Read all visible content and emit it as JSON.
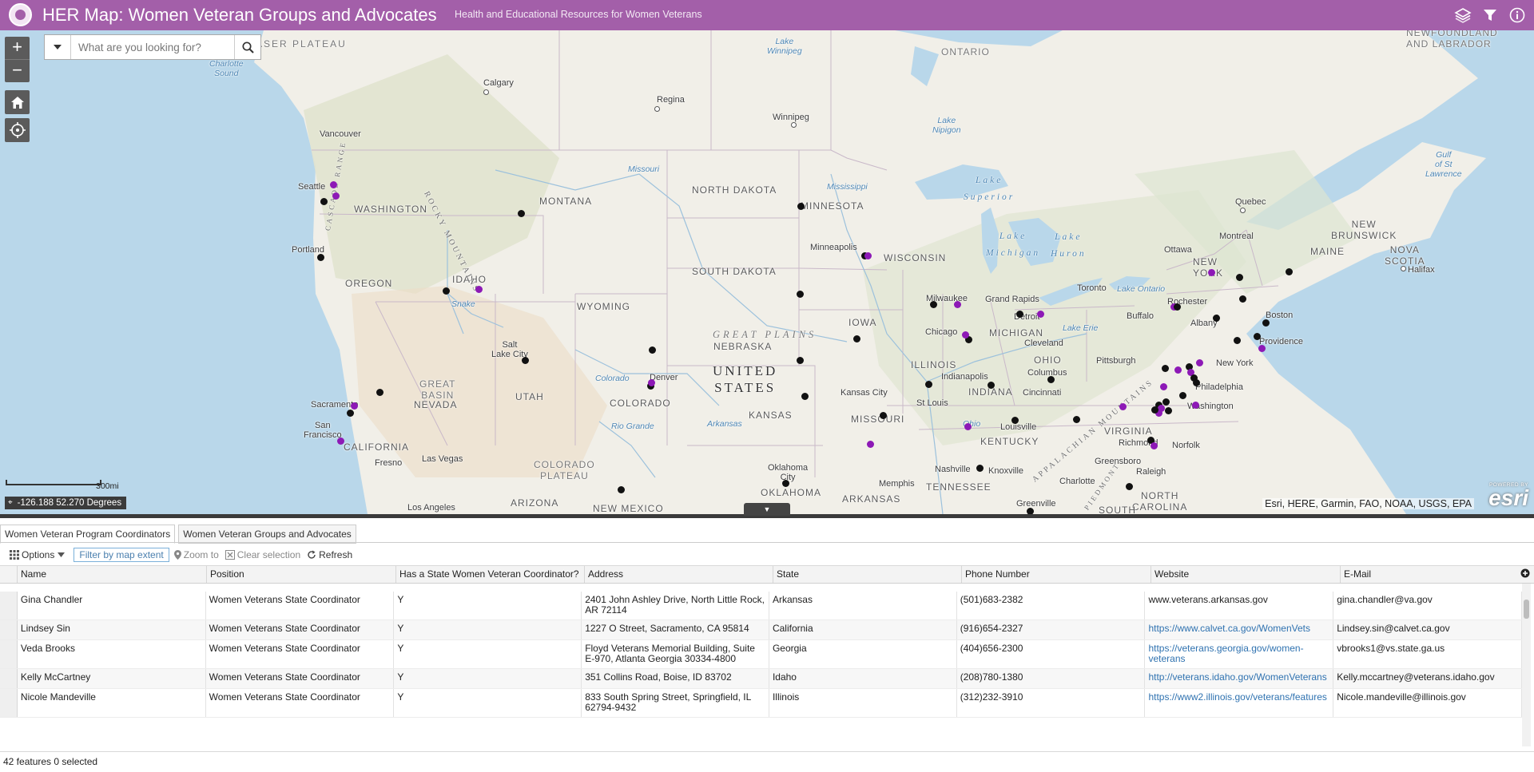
{
  "app": {
    "title": "HER Map: Women Veteran Groups and Advocates",
    "subtitle": "Health and Educational Resources for Women Veterans",
    "header_color": "#a35fa9"
  },
  "header_icons": [
    "layers-icon",
    "filter-icon",
    "info-icon"
  ],
  "search": {
    "placeholder": "What are you looking for?"
  },
  "map": {
    "labels": {
      "fraser_plateau": "FRASER PLATEAU",
      "ontario": "ONTARIO",
      "newfoundland": "NEWFOUNDLAND\nAND LABRADOR",
      "prince_charlotte_sound": "Queen\nCharlotte\nSound",
      "calgary": "Calgary",
      "regina": "Regina",
      "winnipeg": "Winnipeg",
      "lake_winnipeg": "Lake\nWinnipeg",
      "lake_nipigon": "Lake\nNipigon",
      "vancouver": "Vancouver",
      "seattle": "Seattle",
      "washington": "WASHINGTON",
      "montana": "MONTANA",
      "north_dakota": "NORTH DAKOTA",
      "minnesota": "MINNESOTA",
      "missouri_river": "Missouri",
      "mississippi": "Mississippi",
      "lake_superior": "Lake\nSuperior",
      "quebec": "Quebec",
      "gulf_st_lawrence": "Gulf\nof St\nLawrence",
      "new_brunswick": "NEW\nBRUNSWICK",
      "portland": "Portland",
      "oregon": "OREGON",
      "idaho": "IDAHO",
      "snake": "Snake",
      "south_dakota": "SOUTH DAKOTA",
      "minneapolis": "Minneapolis",
      "wisconsin": "WISCONSIN",
      "lake_michigan": "Lake\nMichigan",
      "lake_huron": "Lake\nHuron",
      "ottawa": "Ottawa",
      "montreal": "Montreal",
      "maine": "MAINE",
      "nova_scotia": "NOVA\nSCOTIA",
      "halifax": "Halifax",
      "wyoming": "WYOMING",
      "toronto": "Toronto",
      "lake_ontario": "Lake Ontario",
      "rochester": "Rochester",
      "buffalo": "Buffalo",
      "new_york_state": "NEW\nYORK",
      "albany": "Albany",
      "boston": "Boston",
      "providence": "Providence",
      "milwaukee": "Milwaukee",
      "grand_rapids": "Grand Rapids",
      "detroit": "Detroit",
      "lake_erie": "Lake Erie",
      "chicago": "Chicago",
      "iowa": "IOWA",
      "michigan": "MICHIGAN",
      "cleveland": "Cleveland",
      "salt_lake_city": "Salt\nLake City",
      "great_plains": "GREAT PLAINS",
      "nebraska": "NEBRASKA",
      "united_states": "UNITED\nSTATES",
      "illinois": "ILLINOIS",
      "ohio": "OHIO",
      "columbus": "Columbus",
      "pittsburgh": "Pittsburgh",
      "new_york": "New York",
      "philadelphia": "Philadelphia",
      "sacramento": "Sacramento",
      "great_basin": "GREAT\nBASIN",
      "nevada": "NEVADA",
      "utah": "UTAH",
      "denver": "Denver",
      "colorado": "COLORADO",
      "colorado_river": "Colorado",
      "rio_grande": "Rio Grande",
      "indianapolis": "Indianapolis",
      "indiana": "INDIANA",
      "cincinnati": "Cincinnati",
      "kansas_city": "Kansas City",
      "st_louis": "St Louis",
      "washington_dc": "Washington",
      "san_francisco": "San\nFrancisco",
      "california": "CALIFORNIA",
      "kansas": "KANSAS",
      "arkansas_river": "Arkansas",
      "missouri": "MISSOURI",
      "ohio_river": "Ohio",
      "louisville": "Louisville",
      "kentucky": "KENTUCKY",
      "virginia": "VIRGINIA",
      "richmond": "Richmond",
      "norfolk": "Norfolk",
      "las_vegas": "Las Vegas",
      "fresno": "Fresno",
      "colorado_plateau": "COLORADO\nPLATEAU",
      "oklahoma_city": "Oklahoma\nCity",
      "nashville": "Nashville",
      "knoxville": "Knoxville",
      "greensboro": "Greensboro",
      "raleigh": "Raleigh",
      "tennessee": "TENNESSEE",
      "charlotte": "Charlotte",
      "north_carolina": "NORTH\nCAROLINA",
      "memphis": "Memphis",
      "arizona": "ARIZONA",
      "new_mexico": "NEW MEXICO",
      "oklahoma": "OKLAHOMA",
      "arkansas": "ARKANSAS",
      "greenville": "Greenville",
      "los_angeles": "Los Angeles",
      "rocky_mountains": "ROCKY MOUNTAINS",
      "cascade_range": "CASCADE RANGE",
      "appalachian": "APPALACHIAN MOUNTAINS",
      "piedmont": "PIEDMONT",
      "south": "SOUTH"
    },
    "scale_label": "300mi",
    "coordinates": "-126.188 52.270 Degrees",
    "attribution": "Esri, HERE, Garmin, FAO, NOAA, USGS, EPA",
    "esri_powered": "POWERED BY",
    "esri_word": "esri",
    "point_colors": {
      "coordinator": "#111111",
      "group": "#8d19b6"
    }
  },
  "table": {
    "tabs": [
      "Women Veteran Program Coordinators",
      "Women Veteran Groups and Advocates"
    ],
    "toolbar": {
      "options": "Options",
      "filter": "Filter by map extent",
      "zoom_to": "Zoom to",
      "clear_selection": "Clear selection",
      "refresh": "Refresh"
    },
    "columns": [
      "Name",
      "Position",
      "Has a State Women Veteran Coordinator?",
      "Address",
      "State",
      "Phone Number",
      "Website",
      "E-Mail"
    ],
    "rows": [
      [
        "Gina Chandler",
        "Women Veterans State Coordinator",
        "Y",
        "2401 John Ashley Drive, North Little Rock, AR 72114",
        "Arkansas",
        "(501)683-2382",
        "www.veterans.arkansas.gov",
        " gina.chandler@va.gov"
      ],
      [
        "Lindsey Sin",
        "Women Veterans State Coordinator",
        "Y",
        "1227 O Street, Sacramento, CA 95814",
        "California",
        "(916)654-2327",
        "https://www.calvet.ca.gov/WomenVets",
        "Lindsey.sin@calvet.ca.gov"
      ],
      [
        "Veda Brooks",
        "Women Veterans State Coordinator",
        "Y",
        "Floyd Veterans Memorial Building, Suite E-970, Atlanta Georgia 30334-4800",
        "Georgia",
        "(404)656-2300",
        "https://veterans.georgia.gov/women-veterans",
        "vbrooks1@vs.state.ga.us"
      ],
      [
        "Kelly McCartney",
        "Women Veterans State Coordinator",
        "Y",
        "351 Collins Road, Boise, ID 83702",
        "Idaho",
        "(208)780-1380",
        "http://veterans.idaho.gov/WomenVeterans",
        "Kelly.mccartney@veterans.idaho.gov"
      ],
      [
        "Nicole Mandeville",
        "Women Veterans State Coordinator",
        "Y",
        "833 South Spring Street, Springfield, IL 62794-9432",
        "Illinois",
        "(312)232-3910",
        "https://www2.illinois.gov/veterans/features",
        "Nicole.mandeville@illinois.gov"
      ]
    ],
    "status": "42 features 0 selected"
  }
}
